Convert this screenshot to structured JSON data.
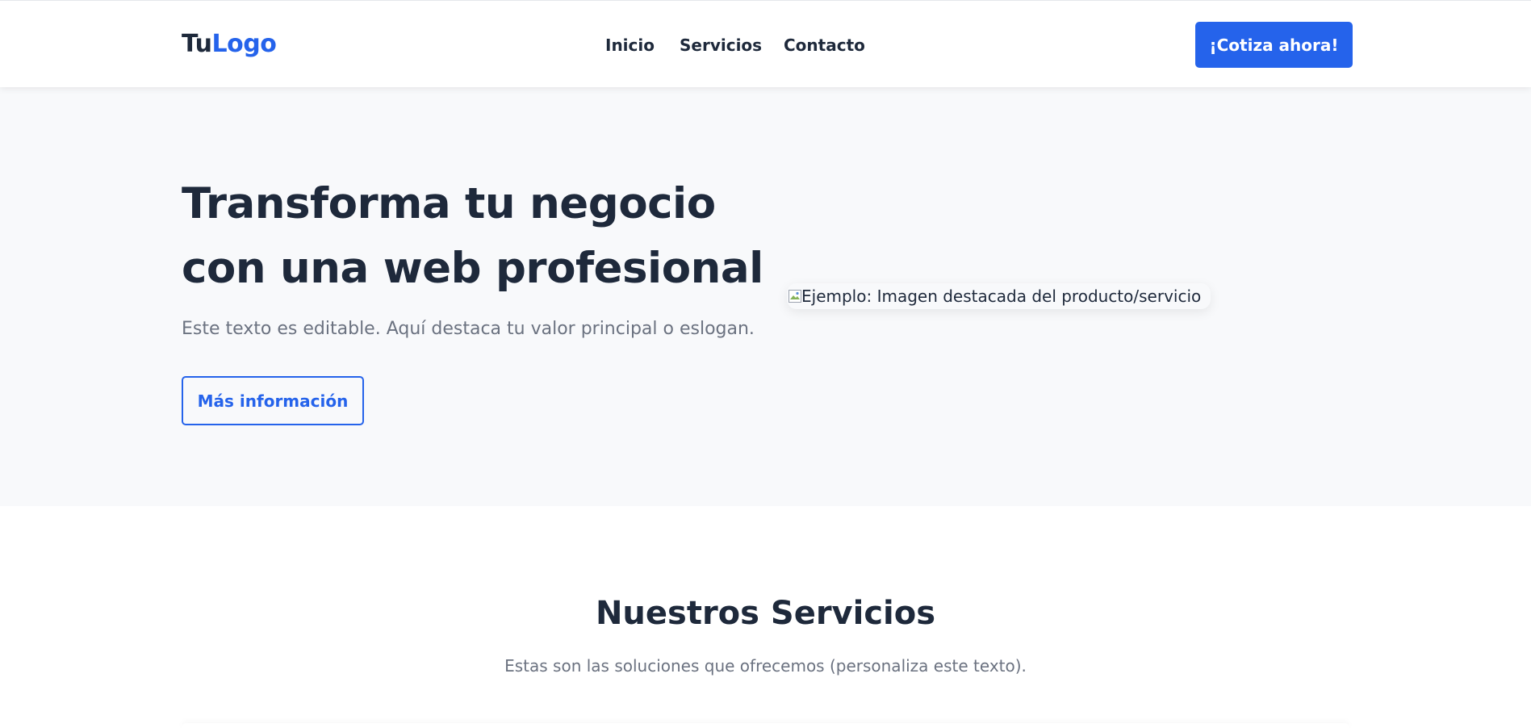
{
  "header": {
    "logo": {
      "part1": "Tu",
      "part2": "Logo"
    },
    "nav": [
      "Inicio",
      "Servicios",
      "Contacto"
    ],
    "cta_label": "¡Cotiza ahora!"
  },
  "hero": {
    "title": "Transforma tu negocio con una web profesional",
    "subtitle": "Este texto es editable. Aquí destaca tu valor principal o eslogan.",
    "button_label": "Más información",
    "image_alt": "Ejemplo: Imagen destacada del producto/servicio",
    "image_icon": "broken-image-icon"
  },
  "services": {
    "title": "Nuestros Servicios",
    "subtitle": "Estas son las soluciones que ofrecemos (personaliza este texto)."
  },
  "colors": {
    "accent": "#2563eb",
    "text": "#1e293b",
    "muted": "#6b7280",
    "hero_bg": "#f8f9fb"
  }
}
